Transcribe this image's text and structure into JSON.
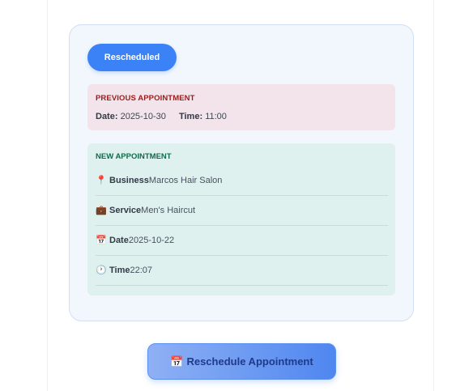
{
  "status": {
    "label": "Rescheduled"
  },
  "previous": {
    "title": "PREVIOUS APPOINTMENT",
    "date_label": "Date:",
    "date_value": "2025-10-30",
    "time_label": "Time:",
    "time_value": "11:00"
  },
  "new_appointment": {
    "title": "NEW APPOINTMENT",
    "rows": [
      {
        "icon": "📍",
        "icon_name": "pin-icon",
        "label": "Business",
        "value": "Marcos Hair Salon"
      },
      {
        "icon": "💼",
        "icon_name": "briefcase-icon",
        "label": "Service",
        "value": "Men's Haircut"
      },
      {
        "icon": "📅",
        "icon_name": "calendar-icon",
        "label": "Date",
        "value": "2025-10-22"
      },
      {
        "icon": "🕐",
        "icon_name": "clock-icon",
        "label": "Time",
        "value": "22:07"
      }
    ]
  },
  "action": {
    "icon": "📅",
    "label": "Reschedule Appointment"
  },
  "colors": {
    "accent": "#3b82f6",
    "previous_bg": "#f2e4ea",
    "previous_title": "#9b1c1c",
    "new_bg": "#def1ee",
    "new_title": "#0f6b4c"
  }
}
